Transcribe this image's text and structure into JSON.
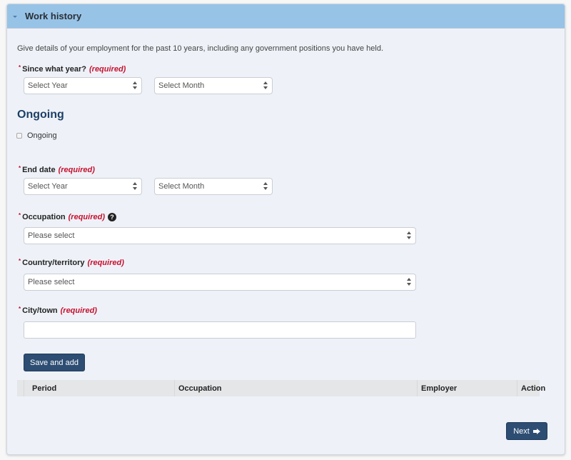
{
  "panel": {
    "title": "Work history",
    "intro": "Give details of your employment for the past 10 years, including any government positions you have held."
  },
  "required_marker": "*",
  "required_text": "(required)",
  "since": {
    "label": "Since what year?",
    "year_value": "Select Year",
    "month_value": "Select Month"
  },
  "ongoing": {
    "heading": "Ongoing",
    "checkbox_label": "Ongoing",
    "checked": false
  },
  "end_date": {
    "label": "End date",
    "year_value": "Select Year",
    "month_value": "Select Month"
  },
  "occupation": {
    "label": "Occupation",
    "help_icon": "question-circle-icon",
    "help_glyph": "?",
    "value": "Please select"
  },
  "country": {
    "label": "Country/territory",
    "value": "Please select"
  },
  "city": {
    "label": "City/town",
    "value": ""
  },
  "buttons": {
    "save_and_add": "Save and add",
    "next": "Next",
    "next_icon": "arrow-right-icon"
  },
  "table": {
    "columns": [
      "Period",
      "Occupation",
      "Employer",
      "Action"
    ],
    "rows": []
  },
  "colors": {
    "header_bg": "#97c3e7",
    "primary_button": "#2d4d73",
    "required": "#c8102e",
    "heading": "#1d3f66"
  }
}
